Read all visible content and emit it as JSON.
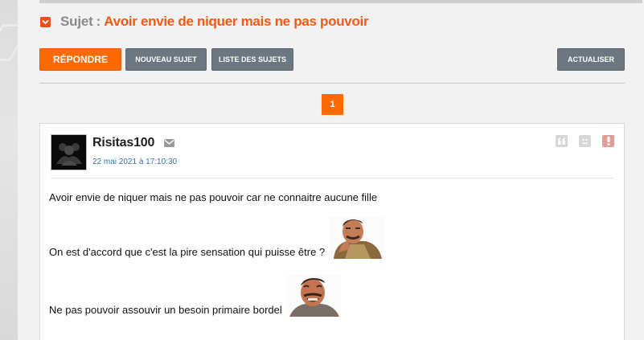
{
  "subject": {
    "prefix": "Sujet",
    "colon": ":",
    "title": "Avoir envie de niquer mais ne pas pouvoir"
  },
  "toolbar": {
    "reply_label": "Répondre",
    "new_topic_label": "Nouveau sujet",
    "topic_list_label": "Liste des sujets",
    "refresh_label": "Actualiser"
  },
  "pagination": {
    "current_page": "1"
  },
  "post": {
    "author": "Risitas100",
    "date": "22 mai 2021 à 17:10:30",
    "lines": [
      "Avoir envie de niquer mais ne pas pouvoir car ne connaitre aucune fille",
      "On est d'accord que c'est la pire sensation qui puisse être ?",
      "Ne pas pouvoir assouvir un besoin primaire bordel"
    ]
  },
  "icons": {
    "subject_toggle": "chevron-down-icon",
    "mail": "envelope-icon",
    "quote": "quote-icon",
    "blacklist": "neutral-face-icon",
    "report": "exclamation-icon"
  },
  "colors": {
    "accent": "#ff6a00",
    "title": "#f25a14",
    "grey_button": "#6c7782",
    "link": "#2f72b8"
  }
}
